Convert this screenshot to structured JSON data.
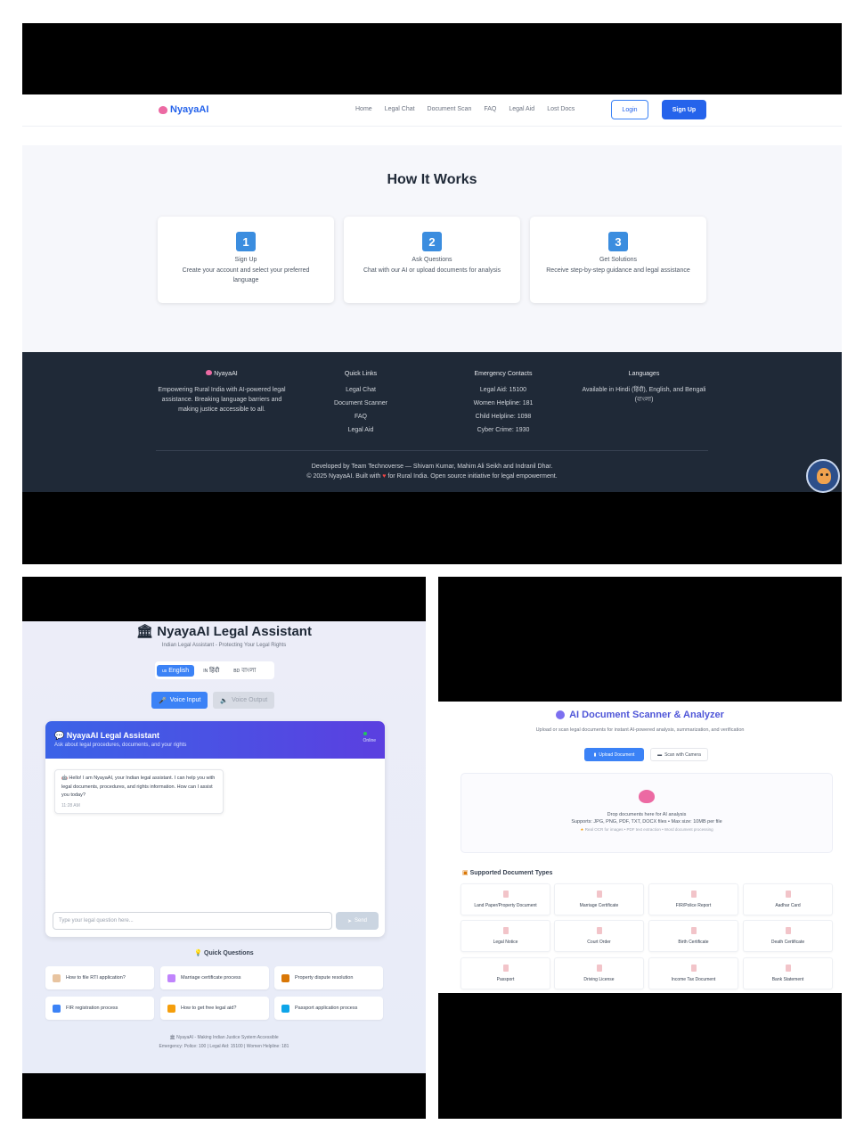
{
  "panel1": {
    "logo": "NyayaAI",
    "nav_links": [
      "Home",
      "Legal Chat",
      "Document Scan",
      "FAQ",
      "Legal Aid",
      "Lost Docs"
    ],
    "login": "Login",
    "signup": "Sign Up",
    "how_title": "How It Works",
    "steps": [
      {
        "num": "1",
        "title": "Sign Up",
        "desc": "Create your account and select your preferred language"
      },
      {
        "num": "2",
        "title": "Ask Questions",
        "desc": "Chat with our AI or upload documents for analysis"
      },
      {
        "num": "3",
        "title": "Get Solutions",
        "desc": "Receive step-by-step guidance and legal assistance"
      }
    ],
    "footer": {
      "brand": "NyayaAI",
      "brand_desc": "Empowering Rural India with AI-powered legal assistance. Breaking language barriers and making justice accessible to all.",
      "quick_title": "Quick Links",
      "quick_links": [
        "Legal Chat",
        "Document Scanner",
        "FAQ",
        "Legal Aid"
      ],
      "emergency_title": "Emergency Contacts",
      "emergency": [
        "Legal Aid: 15100",
        "Women Helpline: 181",
        "Child Helpline: 1098",
        "Cyber Crime: 1930"
      ],
      "languages_title": "Languages",
      "languages_desc": "Available in Hindi (हिंदी), English, and Bengali (বাংলা)",
      "developed": "Developed by Team Technoverse — Shivam Kumar, Mahim Ali Seikh and Indranil Dhar.",
      "copyright_a": "© 2025 NyayaAI. Built with",
      "copyright_b": "for Rural India. Open source initiative for legal empowerment."
    }
  },
  "panel2": {
    "title": "NyayaAI Legal Assistant",
    "subtitle": "Indian Legal Assistant - Protecting Your Legal Rights",
    "languages": [
      "English",
      "हिंदी",
      "বাংলা"
    ],
    "language_codes": [
      "us",
      "IN",
      "BD"
    ],
    "voice_input": "Voice Input",
    "voice_output": "Voice Output",
    "chat_title": "NyayaAI Legal Assistant",
    "chat_subtitle": "Ask about legal procedures, documents, and your rights",
    "status": "Online",
    "greeting": "Hello! I am NyayaAI, your Indian legal assistant. I can help you with legal documents, procedures, and rights information. How can I assist you today?",
    "greeting_time": "11:28 AM",
    "input_placeholder": "Type your legal question here...",
    "send": "Send",
    "quick_title": "Quick Questions",
    "quick_questions": [
      "How to file RTI application?",
      "Marriage certificate process",
      "Property dispute resolution",
      "FIR registration process",
      "How to get free legal aid?",
      "Passport application process"
    ],
    "footer_a": "NyayaAI - Making Indian Justice System Accessible",
    "footer_b": "Emergency: Police: 100 | Legal Aid: 15100 | Women Helpline: 181"
  },
  "panel3": {
    "title": "AI Document Scanner & Analyzer",
    "subtitle": "Upload or scan legal documents for instant AI-powered analysis, summarization, and verification",
    "upload": "Upload Document",
    "camera": "Scan with Camera",
    "drop_a": "Drop documents here for AI analysis",
    "drop_b": "Supports: JPG, PNG, PDF, TXT, DOCX files • Max size: 10MB per file",
    "drop_c": "Real OCR for images • PDF text extraction • Word document processing",
    "supported_title": "Supported Document Types",
    "doc_types": [
      "Land Paper/Property Document",
      "Marriage Certificate",
      "FIR/Police Report",
      "Aadhar Card",
      "Legal Notice",
      "Court Order",
      "Birth Certificate",
      "Death Certificate",
      "Passport",
      "Driving License",
      "Income Tax Document",
      "Bank Statement"
    ]
  },
  "colors": {
    "accent": "#2563eb",
    "footer_bg": "#1f2937",
    "step_num": "#3b8ddf",
    "chat_header": "#4f4fe4"
  }
}
